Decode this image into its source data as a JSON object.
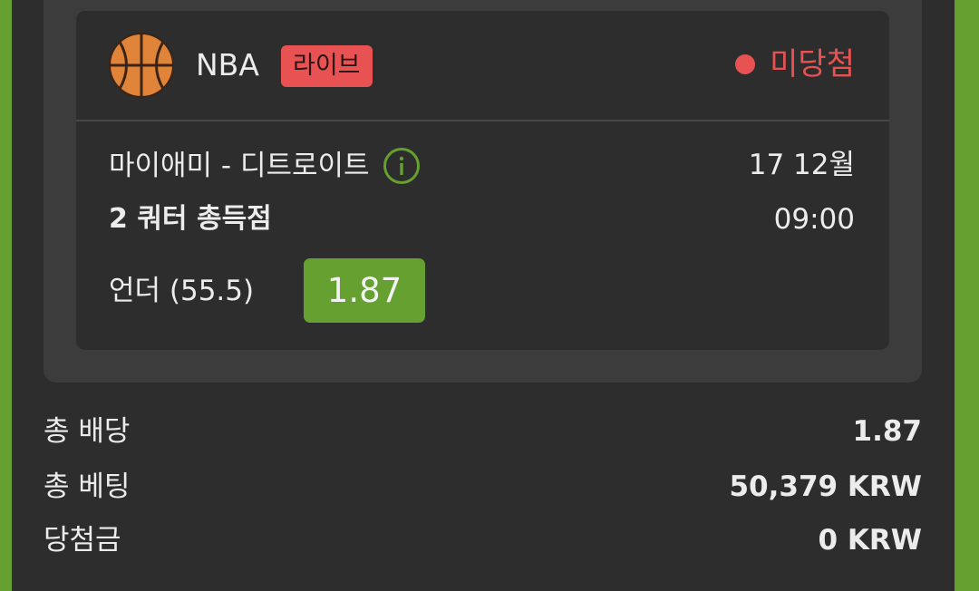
{
  "bet": {
    "league": "NBA",
    "live_badge": "라이브",
    "status": "미당첨",
    "match": "마이애미 - 디트로이트",
    "date": "17 12월",
    "market": "2 쿼터 총득점",
    "time": "09:00",
    "selection": "언더 (55.5)",
    "odds": "1.87",
    "sport_icon": "basketball-icon",
    "info_icon": "info-icon"
  },
  "summary": {
    "total_odds_label": "총 배당",
    "total_odds_value": "1.87",
    "total_stake_label": "총 베팅",
    "total_stake_value": "50,379 KRW",
    "winnings_label": "당첨금",
    "winnings_value": "0 KRW"
  },
  "colors": {
    "accent_green": "#65a030",
    "loss_red": "#e85252",
    "background": "#2d2d2d",
    "card": "#3c3c3c"
  }
}
